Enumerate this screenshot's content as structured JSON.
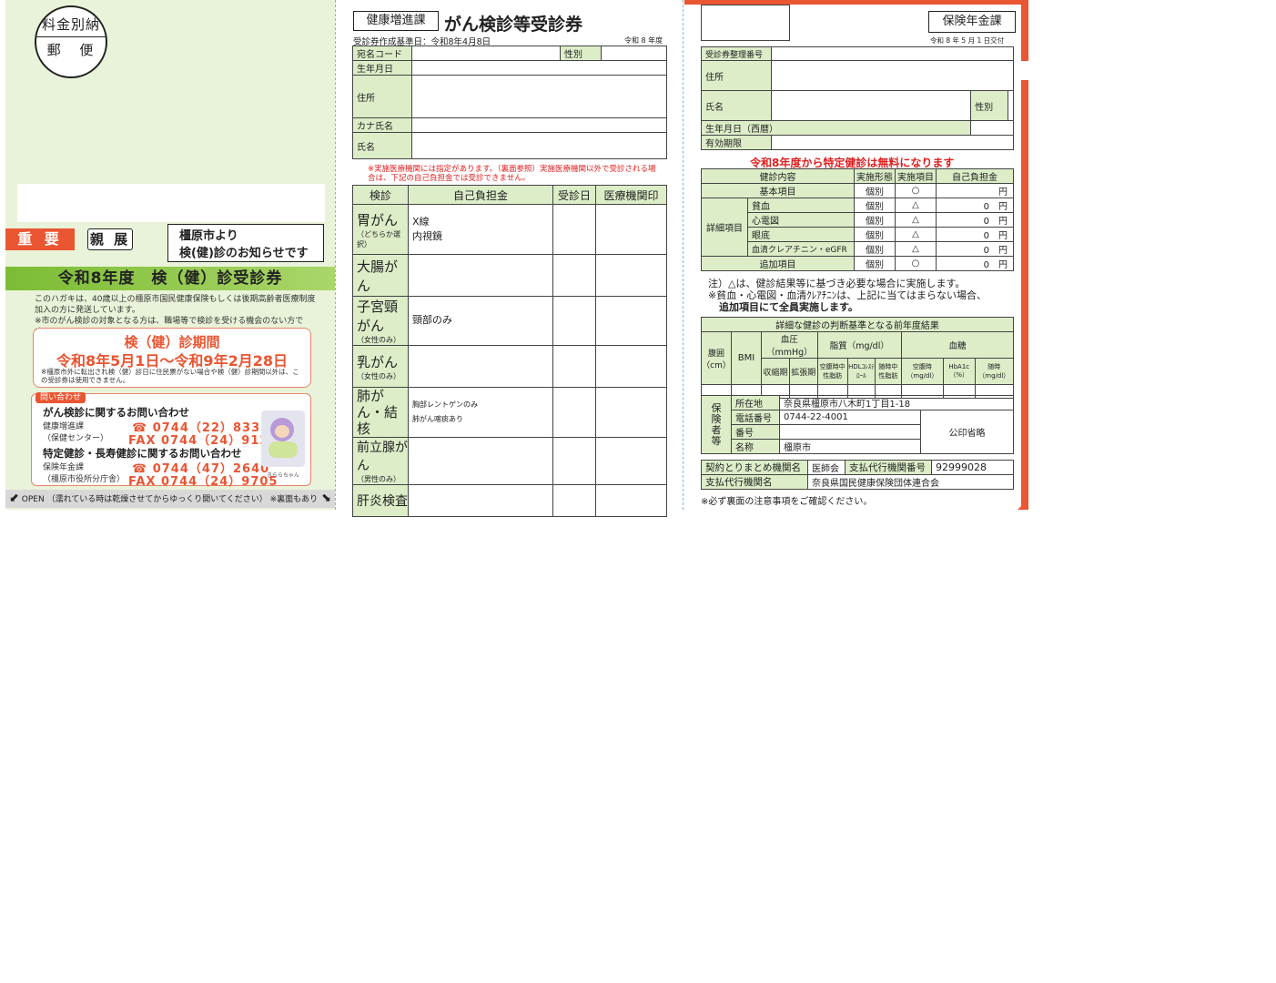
{
  "panel1": {
    "stamp_line1": "料金別納",
    "stamp_line2": "郵 便",
    "important": "重 要",
    "shinten": "親 展",
    "from_line1": "橿原市より",
    "from_line2": "検(健)診のお知らせです",
    "band_title": "令和8年度　検（健）診受診券",
    "desc1": "このハガキは、40歳以上の橿原市国民健康保険もしくは後期高齢者医療制度加入の方に発送しています。",
    "desc2": "※市のがん検診の対象となる方は、職場等で検診を受ける機会のない方です。",
    "period_title": "検（健）診期間",
    "period_range": "令和8年5月1日～令和9年2月28日",
    "period_note": "※橿原市外に転出され検（健）診日に住民票がない場合や検（健）診期間以外は、この受診券は使用できません。",
    "inquiry_tag": "問い合わせ",
    "cancer_inquiry_title": "がん検診に関するお問い合わせ",
    "dept1": "健康増進課",
    "dept1_sub": "（保健センター）",
    "tel1": "☎ 0744（22）8331",
    "fax1": "FAX 0744（24）9124",
    "health_inquiry_title": "特定健診・長寿健診に関するお問い合わせ",
    "dept2": "保険年金課",
    "dept2_sub": "（橿原市役所分庁舎）",
    "tel2": "☎ 0744（47）2640",
    "fax2": "FAX 0744（24）9705",
    "character_name": "きららちゃん",
    "open_text": "OPEN （濡れている時は乾燥させてからゆっくり開いてください） ※裏面もあり"
  },
  "panel2": {
    "dept": "健康増進課",
    "title": "がん検診等受診券",
    "created": "受診券作成基準日：令和8年4月8日",
    "year": "令和 8 年度",
    "fields": [
      "宛名コード",
      "生年月日",
      "住所",
      "カナ氏名",
      "氏名"
    ],
    "gender_label": "性別",
    "note": "※実施医療機関には指定があります。（裏面参照）実施医療機関以外で受診される場合は、下記の自己負担金では受診できません。",
    "headers": [
      "検診",
      "自己負担金",
      "受診日",
      "医療機関印"
    ],
    "rows": [
      {
        "name": "胃がん",
        "sub": "（どちらか選択）",
        "detail1": "X線",
        "detail2": "内視鏡"
      },
      {
        "name": "大腸がん",
        "sub": "",
        "detail1": "",
        "detail2": ""
      },
      {
        "name": "子宮頸がん",
        "sub": "（女性のみ）",
        "detail1": "頸部のみ",
        "detail2": ""
      },
      {
        "name": "乳がん",
        "sub": "（女性のみ）",
        "detail1": "",
        "detail2": ""
      },
      {
        "name": "肺がん・結核",
        "sub": "",
        "detail1": "胸部レントゲンのみ",
        "detail2": "肺がん喀痰あり"
      },
      {
        "name": "前立腺がん",
        "sub": "（男性のみ）",
        "detail1": "",
        "detail2": ""
      },
      {
        "name": "肝炎検査",
        "sub": "",
        "detail1": "",
        "detail2": ""
      }
    ]
  },
  "panel3": {
    "dept": "保険年金課",
    "issued": "令和 8 年 5 月 1 日交付",
    "f_number": "受診券整理番号",
    "f_address": "住所",
    "f_name": "氏名",
    "f_gender": "性別",
    "f_birth": "生年月日（西暦）",
    "f_valid": "有効期限",
    "free_notice": "令和8年度から特定健診は無料になります",
    "exam_headers": [
      "健診内容",
      "実施形態",
      "実施項目",
      "自己負担金"
    ],
    "exam_basic": {
      "name": "基本項目",
      "form": "個別",
      "mark": "○",
      "fee": "円"
    },
    "detail_label": "詳細項目",
    "exam_details": [
      {
        "name": "貧血",
        "form": "個別",
        "mark": "△",
        "fee": "0　円"
      },
      {
        "name": "心電図",
        "form": "個別",
        "mark": "△",
        "fee": "0　円"
      },
      {
        "name": "眼底",
        "form": "個別",
        "mark": "△",
        "fee": "0　円"
      },
      {
        "name": "血清クレアチニン・eGFR",
        "form": "個別",
        "mark": "△",
        "fee": "0　円"
      }
    ],
    "exam_add": {
      "name": "追加項目",
      "form": "個別",
      "mark": "○",
      "fee": "0　円"
    },
    "note1": "注）△は、健診結果等に基づき必要な場合に実施します。",
    "note2": "※貧血・心電図・血清ｸﾚｱﾁﾆﾝは、上記に当てはまらない場合、",
    "note3": "追加項目にて全員実施します。",
    "prev_title": "詳細な健診の判断基準となる前年度結果",
    "prev_groups": [
      "血圧（mmHg）",
      "脂質（mg/dl）",
      "血糖"
    ],
    "prev_cols": [
      "腹囲（cm）",
      "BMI",
      "収縮期",
      "拡張期",
      "空腹時中性脂肪",
      "HDLｺﾚｽﾃﾛｰﾙ",
      "随時中性脂肪",
      "空腹時（mg/dl）",
      "HbA1c（%）",
      "随時（mg/dl）"
    ],
    "insurer_label": "保険者等",
    "ins_addr_label": "所在地",
    "ins_addr": "奈良県橿原市八木町1丁目1-18",
    "ins_tel_label": "電話番号",
    "ins_tel": "0744-22-4001",
    "ins_no_label": "番号",
    "ins_name_label": "名称",
    "ins_name": "橿原市",
    "seal": "公印省略",
    "contract_label": "契約とりまとめ機関名",
    "contract_value": "医師会",
    "agent_no_label": "支払代行機関番号",
    "agent_no": "92999028",
    "agent_label": "支払代行機関名",
    "agent_value": "奈良県国民健康保険団体連合会",
    "footer": "※必ず裏面の注意事項をご確認ください。"
  }
}
